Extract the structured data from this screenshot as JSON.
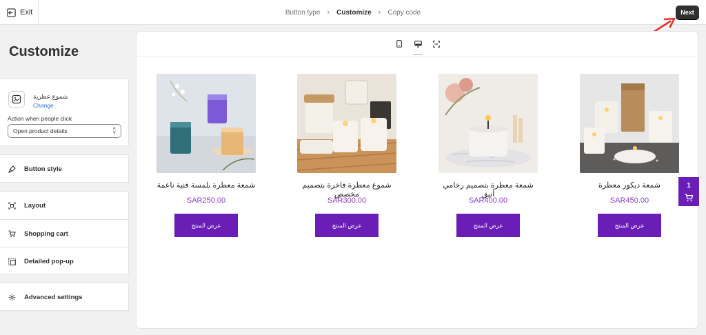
{
  "topbar": {
    "exit_label": "Exit",
    "steps": [
      "Button type",
      "Customize",
      "Copy code"
    ],
    "active_step": "Customize",
    "next_label": "Next",
    "annotation_color": "#e5322d"
  },
  "sidebar": {
    "title": "Customize",
    "product": {
      "name": "شموع عطرية",
      "change_label": "Change",
      "action_label": "Action when people click",
      "action_value": "Open product details"
    },
    "menu": [
      {
        "label": "Button style",
        "icon": "paint-brush-icon"
      },
      {
        "label": "Layout",
        "icon": "layout-icon"
      },
      {
        "label": "Shopping cart",
        "icon": "cart-icon"
      },
      {
        "label": "Detailed pop-up",
        "icon": "popup-icon"
      },
      {
        "label": "Advanced settings",
        "icon": "gear-icon"
      }
    ]
  },
  "preview": {
    "devices": [
      "mobile-icon",
      "desktop-icon",
      "fullscreen-icon"
    ],
    "active_device": "desktop-icon",
    "products": [
      {
        "name": "شمعة معطرة بلمسة فنية ناعمة",
        "price": "SAR250.00",
        "button": "عرض المنتج"
      },
      {
        "name": "شموع معطرة فاخرة بتصميم مخصص",
        "price": "SAR300.00",
        "button": "عرض المنتج"
      },
      {
        "name": "شمعة معطرة بتصميم رخامي أنيق",
        "price": "SAR400.00",
        "button": "عرض المنتج"
      },
      {
        "name": "شمعة ديكور معطرة",
        "price": "SAR450.00",
        "button": "عرض المنتج"
      }
    ],
    "cart": {
      "count": "1"
    },
    "accent_color": "#6a1eb7",
    "price_color": "#8e3ec9"
  }
}
